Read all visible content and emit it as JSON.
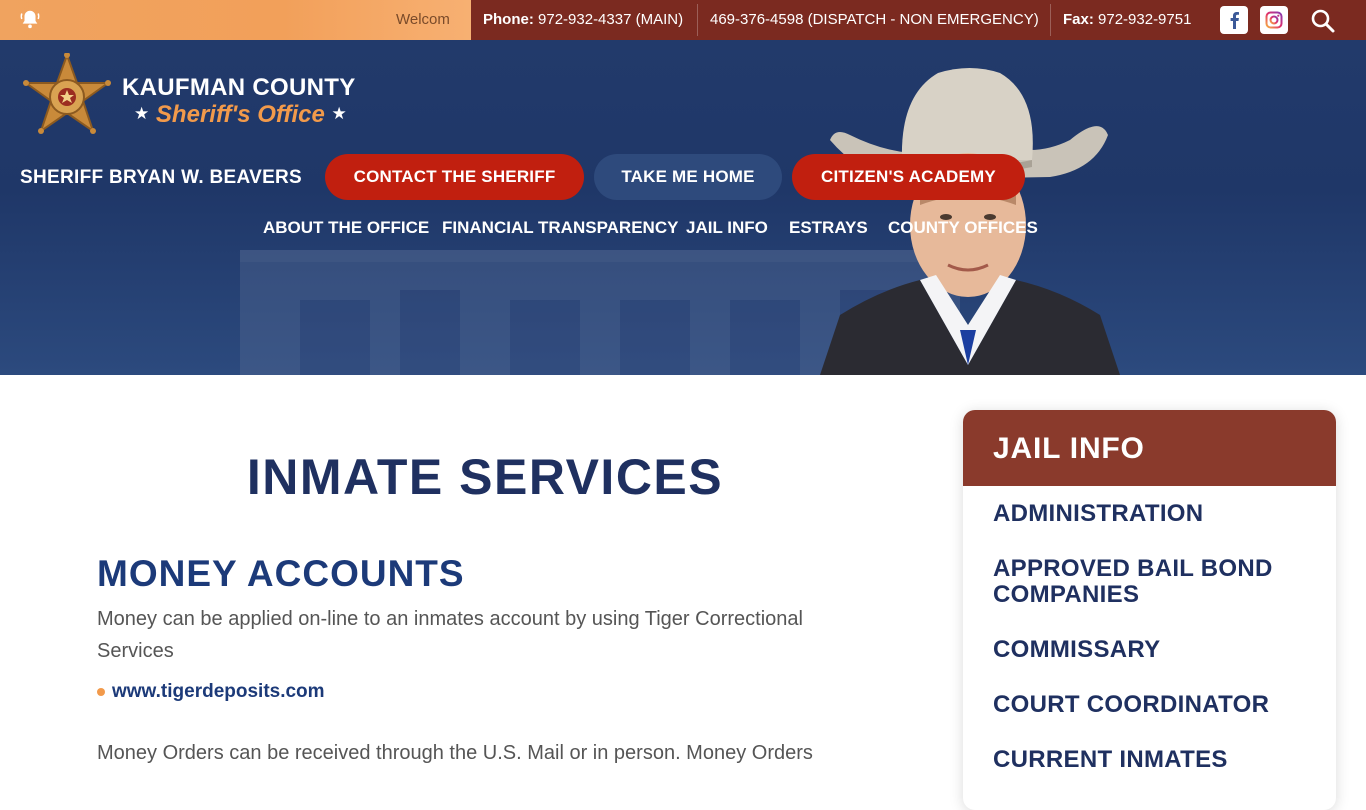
{
  "topbar": {
    "welcome": "Welcom",
    "phone_label": "Phone:",
    "phone_value": "972-932-4337 (MAIN)",
    "dispatch": "469-376-4598 (DISPATCH - NON EMERGENCY)",
    "fax_label": "Fax:",
    "fax_value": "972-932-9751",
    "icons": [
      "bell-icon",
      "facebook-icon",
      "instagram-icon",
      "search-icon"
    ]
  },
  "header": {
    "logo_title": "KAUFMAN COUNTY",
    "logo_subtitle": "Sheriff's Office",
    "sheriff_name": "SHERIFF BRYAN W. BEAVERS",
    "buttons": {
      "contact": "CONTACT THE SHERIFF",
      "home": "TAKE ME HOME",
      "academy": "CITIZEN'S ACADEMY"
    },
    "nav": [
      "ABOUT THE OFFICE",
      "FINANCIAL TRANSPARENCY",
      "JAIL INFO",
      "ESTRAYS",
      "COUNTY OFFICES"
    ]
  },
  "main": {
    "page_title": "INMATE SERVICES",
    "section_title": "MONEY ACCOUNTS",
    "para1": "Money can be applied on-line to an inmates account by using Tiger Correctional Services",
    "link": "www.tigerdeposits.com",
    "para2": "Money Orders can be received through the U.S. Mail or in person. Money Orders"
  },
  "sidebar": {
    "title": "JAIL INFO",
    "items": [
      "ADMINISTRATION",
      "APPROVED BAIL BOND COMPANIES",
      "COMMISSARY",
      "COURT COORDINATOR",
      "CURRENT INMATES"
    ]
  },
  "colors": {
    "top_orange": "#f2a05a",
    "top_maroon": "#7b2a20",
    "hero_navy": "#223a6b",
    "button_red": "#c11f0f",
    "button_blue": "#2e4a7c",
    "title_navy": "#1f3060",
    "sidebar_head": "#8a3a2c",
    "accent_orange": "#f29a4b"
  }
}
